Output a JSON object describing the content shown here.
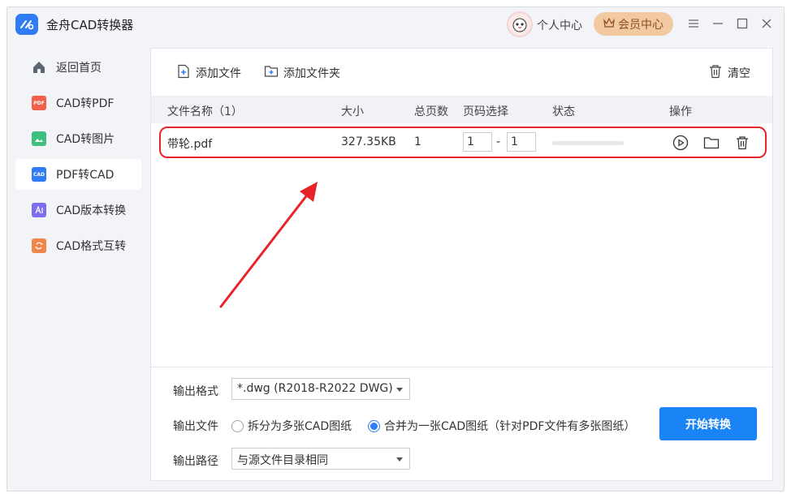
{
  "app": {
    "title": "金舟CAD转换器"
  },
  "titlebar": {
    "user_center": "个人中心",
    "vip_center": "会员中心"
  },
  "sidebar": {
    "items": [
      {
        "label": "返回首页",
        "icon": "home-icon",
        "active": false
      },
      {
        "label": "CAD转PDF",
        "icon": "pdf-file-icon",
        "active": false
      },
      {
        "label": "CAD转图片",
        "icon": "image-file-icon",
        "active": false
      },
      {
        "label": "PDF转CAD",
        "icon": "cad-file-icon",
        "active": true
      },
      {
        "label": "CAD版本转换",
        "icon": "version-file-icon",
        "active": false
      },
      {
        "label": "CAD格式互转",
        "icon": "format-convert-icon",
        "active": false
      }
    ]
  },
  "toolbar": {
    "add_file": "添加文件",
    "add_folder": "添加文件夹",
    "clear": "清空"
  },
  "table": {
    "headers": {
      "name": "文件名称（1）",
      "size": "大小",
      "pages": "总页数",
      "page_select": "页码选择",
      "status": "状态",
      "actions": "操作"
    },
    "rows": [
      {
        "name": "带轮.pdf",
        "size": "327.35KB",
        "pages": "1",
        "page_from": "1",
        "page_sep": "-",
        "page_to": "1",
        "progress": 0
      }
    ]
  },
  "output": {
    "format_label": "输出格式",
    "format_value": "*.dwg (R2018-R2022 DWG)",
    "file_label": "输出文件",
    "option_split": "拆分为多张CAD图纸",
    "option_merge": "合并为一张CAD图纸（针对PDF文件有多张图纸）",
    "merge_selected": true,
    "path_label": "输出路径",
    "path_value": "与源文件目录相同"
  },
  "start_button": "开始转换",
  "colors": {
    "accent": "#1a83f5",
    "highlight": "#e8232a",
    "vip_bg": "#f3c9a2"
  }
}
